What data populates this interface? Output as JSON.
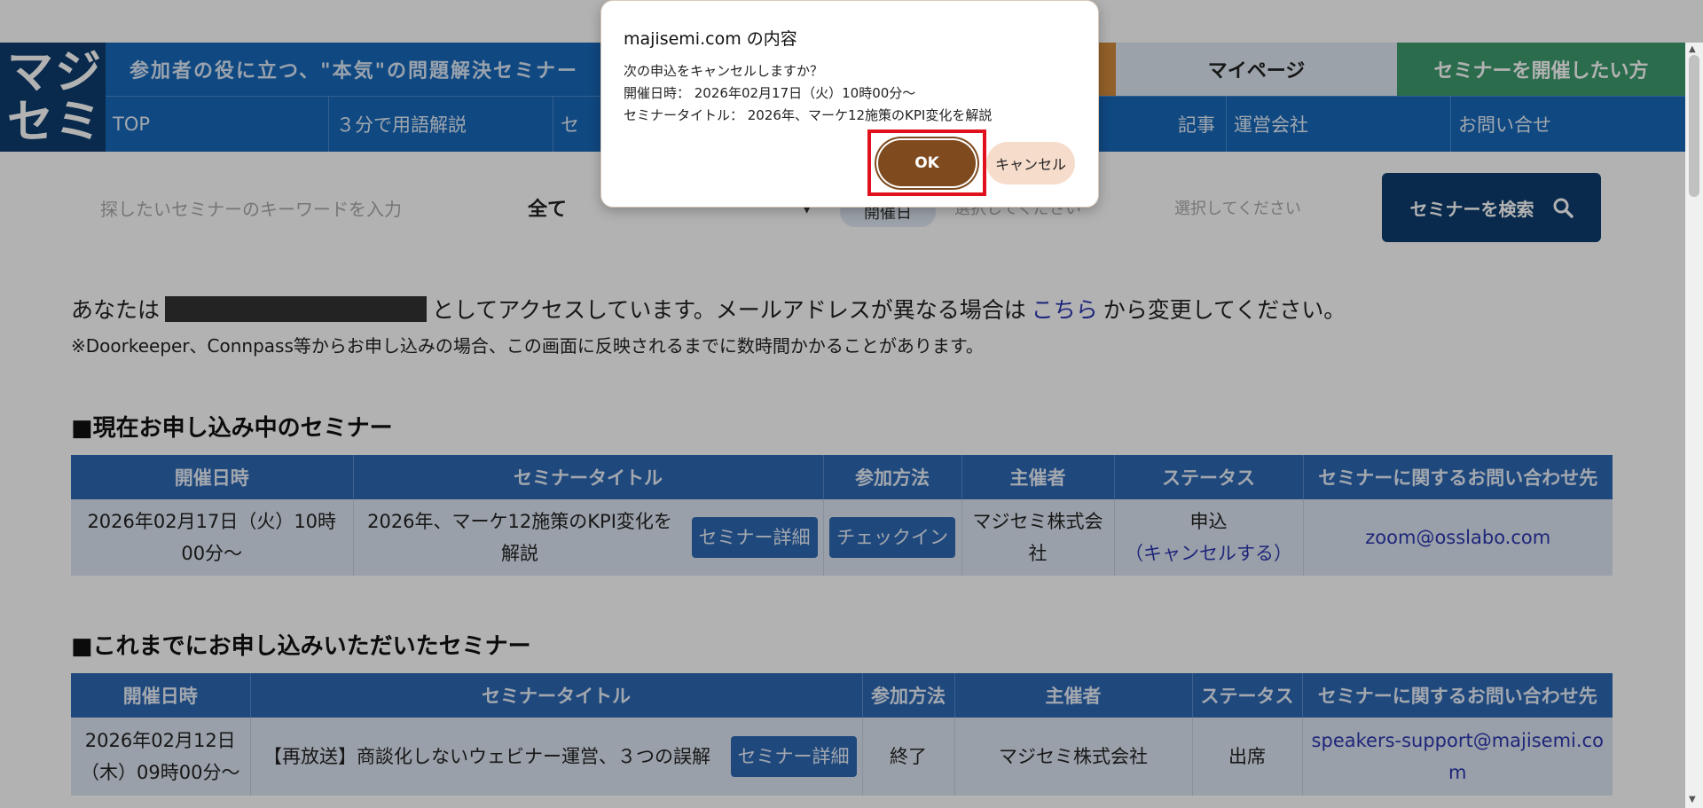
{
  "header": {
    "logo_line1": "マジ",
    "logo_line2": "セミ",
    "tagline": "参加者の役に立つ、\"本気\"の問題解決セミナー",
    "mypage_label": "マイページ",
    "host_label": "セミナーを開催したい方"
  },
  "nav": {
    "items": [
      {
        "label": "TOP"
      },
      {
        "label": "３分で用語解説"
      },
      {
        "label": "セ"
      },
      {
        "label": ""
      },
      {
        "label": "記事"
      },
      {
        "label": "運営会社"
      },
      {
        "label": "お問い合せ"
      }
    ]
  },
  "search": {
    "keyword_placeholder": "探したいセミナーのキーワードを入力",
    "category_value": "全て",
    "date_label": "開催日",
    "date_from_placeholder": "選択してください",
    "date_tilde": "〜",
    "date_to_placeholder": "選択してください",
    "button_label": "セミナーを検索"
  },
  "notice": {
    "prefix": "あなたは",
    "middle": "としてアクセスしています。メールアドレスが異なる場合は",
    "link": "こちら",
    "suffix": "から変更してください。",
    "subnote": "※Doorkeeper、Connpass等からお申し込みの場合、この画面に反映されるまでに数時間かかることがあります。"
  },
  "current": {
    "title": "■現在お申し込み中のセミナー",
    "headers": [
      "開催日時",
      "セミナータイトル",
      "参加方法",
      "主催者",
      "ステータス",
      "セミナーに関するお問い合わせ先"
    ],
    "row": {
      "date": "2026年02月17日（火）10時00分〜",
      "title": "2026年、マーケ12施策のKPI変化を解説",
      "detail_button": "セミナー詳細",
      "checkin_button": "チェックイン",
      "organizer": "マジセミ株式会社",
      "status": "申込",
      "cancel_link": "（キャンセルする）",
      "contact": "zoom@osslabo.com"
    }
  },
  "past": {
    "title": "■これまでにお申し込みいただいたセミナー",
    "headers": [
      "開催日時",
      "セミナータイトル",
      "参加方法",
      "主催者",
      "ステータス",
      "セミナーに関するお問い合わせ先"
    ],
    "row": {
      "date": "2026年02月12日（木）09時00分〜",
      "title": "【再放送】商談化しないウェビナー運営、３つの誤解",
      "detail_button": "セミナー詳細",
      "method": "終了",
      "organizer": "マジセミ株式会社",
      "status": "出席",
      "contact": "speakers-support@majisemi.com"
    }
  },
  "dialog": {
    "title": "majisemi.com の内容",
    "line1": "次の申込をキャンセルしますか？",
    "line2": "開催日時： 2026年02月17日（火）10時00分〜",
    "line3": "セミナータイトル： 2026年、マーケ12施策のKPI変化を解説",
    "ok_label": "OK",
    "cancel_label": "キャンセル"
  },
  "icons": {
    "search": "magnifier-icon",
    "select": "chevron-down-icon"
  },
  "colors": {
    "header_blue": "#1767b9",
    "dark_navy": "#0d3d6e",
    "ok_brown": "#7e4a1e",
    "highlight_red": "#e0101c"
  }
}
